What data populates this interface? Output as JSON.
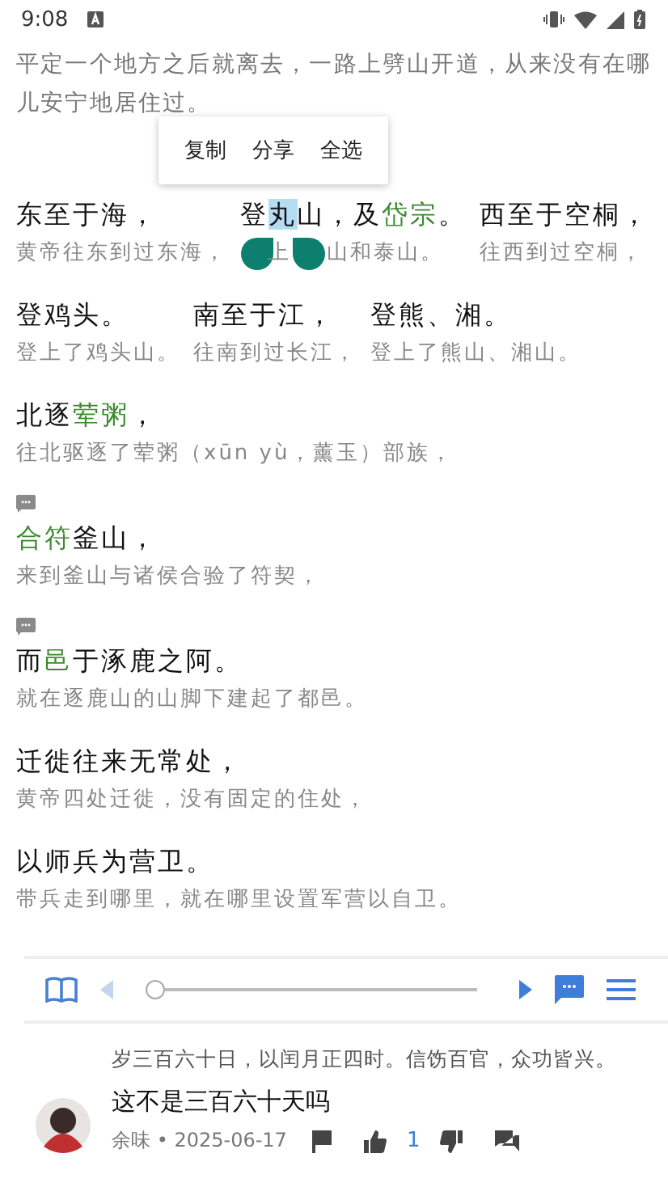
{
  "status_bar": {
    "time": "9:08"
  },
  "preceding_translation": "平定一个地方之后就离去，一路上劈山开道，从来没有在哪儿安宁地居住过。",
  "context_menu": [
    "复制",
    "分享",
    "全选"
  ],
  "passages": [
    {
      "note": false,
      "segments": [
        {
          "original": [
            {
              "text": "东至于海，",
              "kind": "plain"
            }
          ],
          "translation": "黄帝往东到过东海，"
        },
        {
          "original": [
            {
              "text": "登",
              "kind": "plain"
            },
            {
              "text": "丸",
              "kind": "selected"
            },
            {
              "text": "山，及",
              "kind": "plain"
            },
            {
              "text": "岱宗",
              "kind": "term"
            },
            {
              "text": "。",
              "kind": "plain"
            }
          ],
          "translation_parts": [
            "上",
            "山和泰山。"
          ]
        },
        {
          "original": [
            {
              "text": "西至于空桐，",
              "kind": "plain"
            }
          ],
          "translation": "往西到过空桐，"
        }
      ]
    },
    {
      "note": false,
      "segments": [
        {
          "original": [
            {
              "text": "登鸡头。",
              "kind": "plain"
            }
          ],
          "translation": "登上了鸡头山。"
        },
        {
          "original": [
            {
              "text": "南至于江，",
              "kind": "plain"
            }
          ],
          "translation": "往南到过长江，"
        },
        {
          "original": [
            {
              "text": "登熊、湘。",
              "kind": "plain"
            }
          ],
          "translation": "登上了熊山、湘山。"
        }
      ]
    },
    {
      "note": false,
      "segments": [
        {
          "original": [
            {
              "text": "北逐",
              "kind": "plain"
            },
            {
              "text": "荤粥",
              "kind": "term"
            },
            {
              "text": "，",
              "kind": "plain"
            }
          ],
          "translation": "往北驱逐了荤粥（xūn yù，薰玉）部族，"
        }
      ]
    },
    {
      "note": true,
      "segments": [
        {
          "original": [
            {
              "text": "合符",
              "kind": "term"
            },
            {
              "text": "釜山，",
              "kind": "plain"
            }
          ],
          "translation": "来到釜山与诸侯合验了符契，"
        }
      ]
    },
    {
      "note": true,
      "segments": [
        {
          "original": [
            {
              "text": "而",
              "kind": "plain"
            },
            {
              "text": "邑",
              "kind": "term"
            },
            {
              "text": "于涿鹿之阿。",
              "kind": "plain"
            }
          ],
          "translation": "就在逐鹿山的山脚下建起了都邑。"
        }
      ]
    },
    {
      "note": false,
      "segments": [
        {
          "original": [
            {
              "text": "迁徙往来无常处，",
              "kind": "plain"
            }
          ],
          "translation": "黄帝四处迁徙，没有固定的住处，"
        }
      ]
    },
    {
      "note": false,
      "segments": [
        {
          "original": [
            {
              "text": "以师兵为营卫。",
              "kind": "plain"
            }
          ],
          "translation": "带兵走到哪里，就在哪里设置军营以自卫。"
        }
      ]
    }
  ],
  "toolbar": {
    "prev_button": {
      "disabled": true
    },
    "progress": {
      "level": 0
    },
    "next_button": {
      "disabled": false
    }
  },
  "comment": {
    "quote": "岁三百六十日，以闰月正四时。信饬百官，众功皆兴。",
    "text": "这不是三百六十天吗",
    "meta": "余味 • 2025-06-17",
    "likes": "1"
  }
}
